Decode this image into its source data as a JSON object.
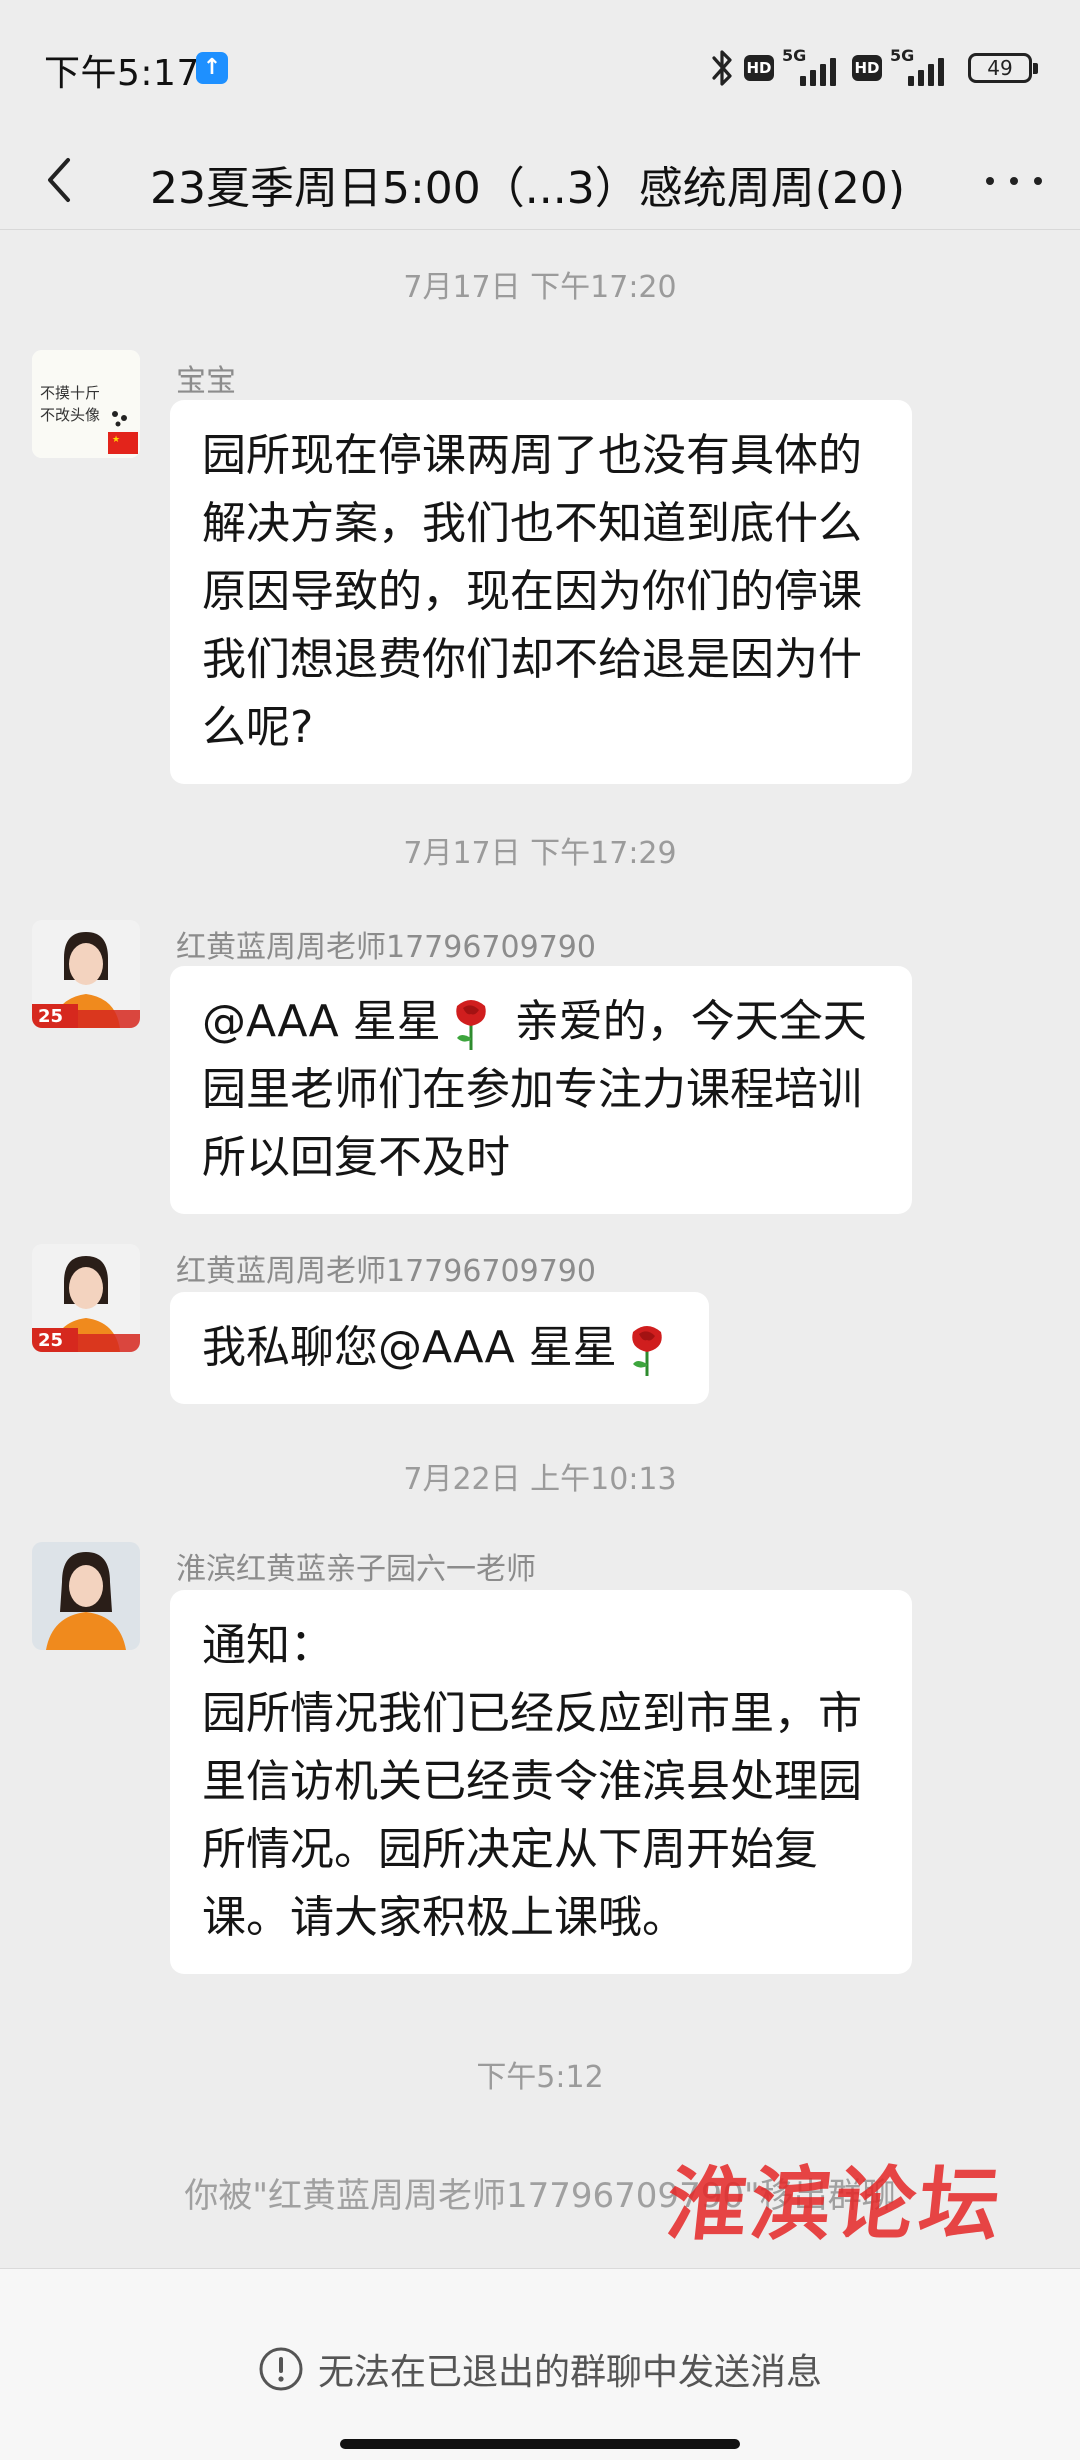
{
  "status_bar": {
    "time": "下午5:17",
    "upload_icon": "arrow-up-icon",
    "hd_label": "HD",
    "network_label": "5G",
    "battery": "49"
  },
  "header": {
    "title": "23夏季周日5:00（...3）感统周周(20)",
    "back_icon": "chevron-left-icon",
    "more_icon": "more-dots-icon"
  },
  "messages": [
    {
      "timestamp": "7月17日 下午17:20",
      "sender": "宝宝",
      "avatar_text": [
        "不摸十斤",
        "不改头像"
      ],
      "text": "园所现在停课两周了也没有具体的解决方案，我们也不知道到底什么原因导致的，现在因为你们的停课我们想退费你们却不给退是因为什么呢?"
    },
    {
      "timestamp": "7月17日 下午17:29",
      "sender": "红黄蓝周周老师17796709790",
      "avatar_badge": "25",
      "mention": "@AAA 星星",
      "text": " 亲爱的，今天全天园里老师们在参加专注力课程培训 所以回复不及时"
    },
    {
      "sender": "红黄蓝周周老师17796709790",
      "avatar_badge": "25",
      "text": "我私聊您@AAA 星星"
    },
    {
      "timestamp": "7月22日 上午10:13",
      "sender": "淮滨红黄蓝亲子园六一老师",
      "text": "通知：\n园所情况我们已经反应到市里，市里信访机关已经责令淮滨县处理园所情况。园所决定从下周开始复课。请大家积极上课哦。"
    }
  ],
  "last_timestamp": "下午5:12",
  "system_message": "你被\"红黄蓝周周老师17796709790\"移出群聊",
  "watermark": "淮滨论坛",
  "footer": {
    "notice": "无法在已退出的群聊中发送消息",
    "notice_icon": "exclamation-circle-icon"
  },
  "colors": {
    "background": "#EDEDED",
    "bubble": "#FFFFFF",
    "watermark": "#E42828",
    "upload_badge": "#1E90FF",
    "teacher_uniform": "#F08A1D"
  }
}
